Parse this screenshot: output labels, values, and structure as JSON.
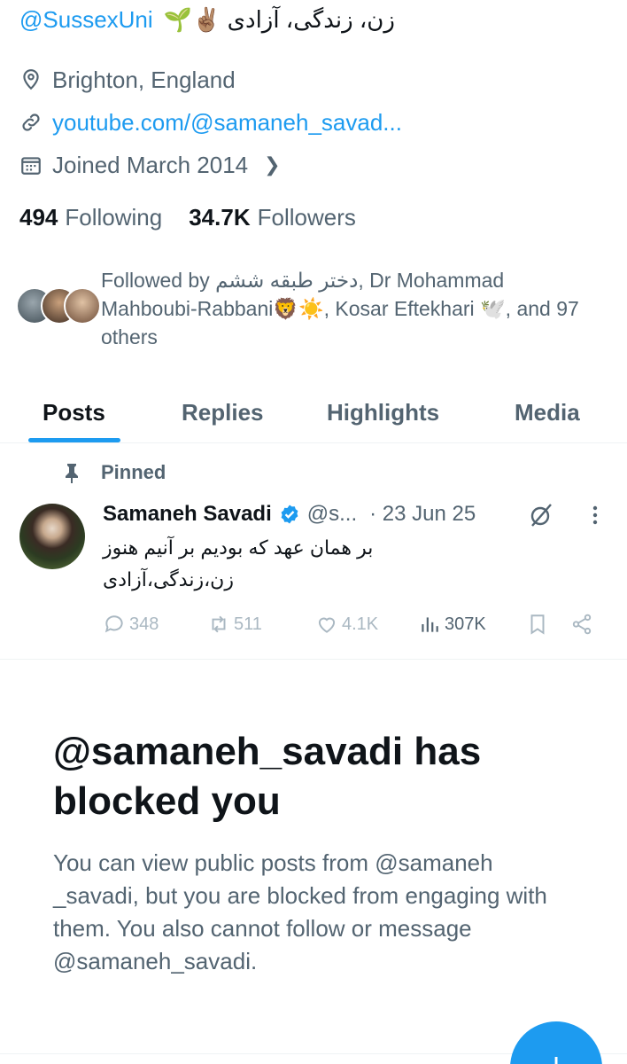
{
  "bio": {
    "mention": "@SussexUni",
    "text": "زن، زندگی، آزادی ✌🏽🌱"
  },
  "profile_meta": {
    "location": "Brighton, England",
    "link": "youtube.com/@samaneh_savad...",
    "joined": "Joined March 2014"
  },
  "stats": {
    "following_count": "494",
    "following_label": "Following",
    "followers_count": "34.7K",
    "followers_label": "Followers"
  },
  "followed_by": {
    "text": "Followed by دختر طبقه ششم, Dr Mohammad Mahboubi-Rabbani🦁☀️, Kosar Eftekhari 🕊️, and 97 others"
  },
  "tabs": [
    {
      "label": "Posts",
      "active": true
    },
    {
      "label": "Replies",
      "active": false
    },
    {
      "label": "Highlights",
      "active": false
    },
    {
      "label": "Media",
      "active": false
    }
  ],
  "post": {
    "pinned_label": "Pinned",
    "author_name": "Samaneh Savadi",
    "handle": "@s...",
    "date": "· 23 Jun 25",
    "body_line1": "بر همان عهد که بودیم بر آنیم هنوز",
    "body_line2": "زن،زندگی،آزادی",
    "replies": "348",
    "reposts": "511",
    "likes": "4.1K",
    "views": "307K"
  },
  "blocked": {
    "title": "@samaneh_savadi has blocked you",
    "description": "You can view public posts from @samaneh _savadi, but you are blocked from engaging with them. You also cannot follow or message @samaneh_savadi."
  },
  "fab": {
    "label": "+"
  },
  "colors": {
    "accent": "#1d9bf0",
    "secondary_text": "#536471",
    "primary_text": "#0f1419"
  }
}
